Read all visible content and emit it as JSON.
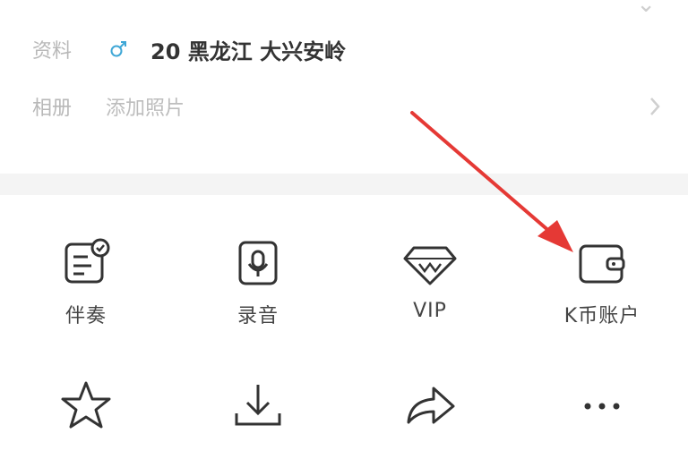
{
  "profile": {
    "label": "资料",
    "value": "20  黑龙江 大兴安岭",
    "gender_icon": "male-icon",
    "gender_color": "#3fa7d6"
  },
  "album": {
    "label": "相册",
    "value": "添加照片"
  },
  "menu": {
    "items": [
      {
        "label": "伴奏",
        "icon": "accompaniment-icon"
      },
      {
        "label": "录音",
        "icon": "recording-icon"
      },
      {
        "label": "VIP",
        "icon": "vip-diamond-icon"
      },
      {
        "label": "K币账户",
        "icon": "wallet-icon"
      },
      {
        "label": "",
        "icon": "star-icon"
      },
      {
        "label": "",
        "icon": "download-icon"
      },
      {
        "label": "",
        "icon": "share-icon"
      },
      {
        "label": "",
        "icon": "more-icon"
      }
    ]
  },
  "colors": {
    "icon_stroke": "#333333",
    "annotation_arrow": "#e53935",
    "divider": "#f4f4f4"
  }
}
